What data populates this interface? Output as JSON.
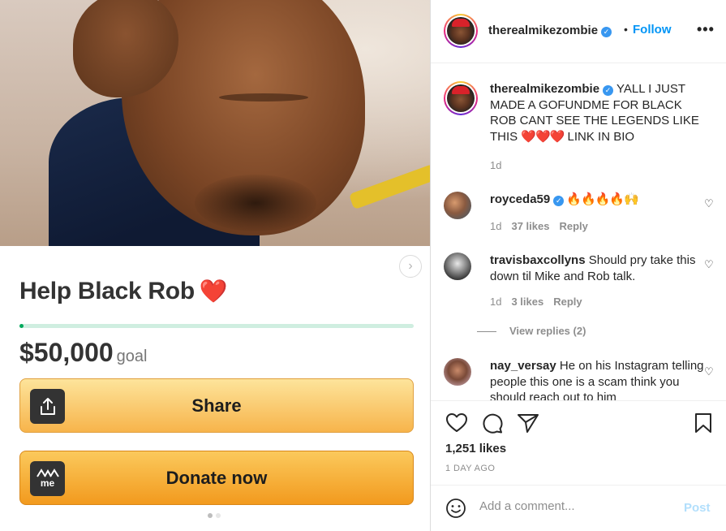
{
  "post": {
    "media": {
      "campaign_title": "Help Black Rob",
      "title_emoji": "❤️",
      "amount": "$50,000",
      "goal_label": "goal",
      "progress_fraction": 0.01,
      "share_label": "Share",
      "donate_label": "Donate now",
      "donate_icon_text": "me",
      "next_glyph": "›"
    },
    "header": {
      "username": "therealmikezombie",
      "verified_glyph": "✓",
      "separator": "•",
      "follow_label": "Follow",
      "more_glyph": "•••"
    },
    "caption": {
      "username": "therealmikezombie",
      "verified_glyph": "✓",
      "text_1": " YALL I JUST MADE A GOFUNDME FOR BLACK ROB CANT SEE THE LEGENDS LIKE THIS ",
      "hearts": "❤️❤️❤️",
      "text_2": " LINK IN BIO",
      "time": "1d"
    },
    "comments": [
      {
        "username": "royceda59",
        "verified_glyph": "✓",
        "text": " 🔥🔥🔥🔥🙌",
        "time": "1d",
        "likes": "37 likes",
        "reply": "Reply",
        "like_glyph": "♡"
      },
      {
        "username": "travisbaxcollyns",
        "text": " Should pry take this down til Mike and Rob talk.",
        "time": "1d",
        "likes": "3 likes",
        "reply": "Reply",
        "like_glyph": "♡",
        "view_replies": "View replies (2)"
      },
      {
        "username": "nay_versay",
        "text": " He on his Instagram telling people this one is a scam think you should reach out to him",
        "like_glyph": "♡"
      }
    ],
    "actions": {
      "likes": "1,251 likes",
      "time_ago": "1 DAY AGO"
    },
    "add_comment": {
      "placeholder": "Add a comment...",
      "post_label": "Post"
    }
  },
  "colors": {
    "link_blue": "#0095f6",
    "verified_blue": "#3897f0",
    "gofundme_green": "#02a95c",
    "button_orange": "#f7b44b",
    "post_disabled": "#b2dffc"
  },
  "icons": [
    "share-upload-icon",
    "gofundme-me-icon",
    "chevron-right-icon",
    "verified-badge-icon",
    "more-options-icon",
    "heart-icon",
    "comment-icon",
    "send-icon",
    "bookmark-icon",
    "smiley-icon"
  ]
}
